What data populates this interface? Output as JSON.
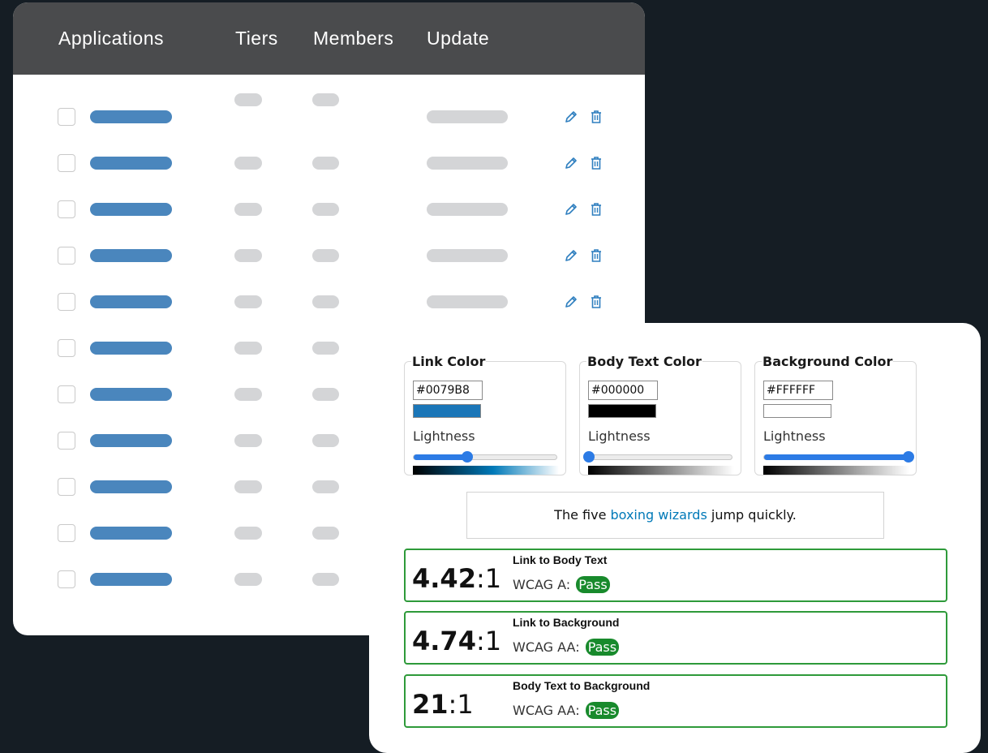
{
  "table": {
    "columns": {
      "applications": "Applications",
      "tiers": "Tiers",
      "members": "Members",
      "update": "Update"
    },
    "row_count": 11,
    "colors": {
      "header_bg": "#4a4b4d",
      "app_bar": "#4a86bd",
      "placeholder_bar": "#d4d5d7",
      "icon": "#2f7fbf"
    },
    "row_icons": [
      "pencil-icon",
      "trash-icon"
    ]
  },
  "contrast_checker": {
    "pickers": [
      {
        "legend": "Link Color",
        "hex": "#0079B8",
        "lightness_label": "Lightness",
        "lightness": 0.37,
        "swatch": "#1a76b8"
      },
      {
        "legend": "Body Text Color",
        "hex": "#000000",
        "lightness_label": "Lightness",
        "lightness": 0.0,
        "swatch": "#000000"
      },
      {
        "legend": "Background Color",
        "hex": "#FFFFFF",
        "lightness_label": "Lightness",
        "lightness": 1.0,
        "swatch": "#ffffff"
      }
    ],
    "sample": {
      "before": "The five ",
      "link": "boxing wizards",
      "after": " jump quickly."
    },
    "results": [
      {
        "ratio": "4.42",
        "suffix": ":1",
        "title": "Link to Body Text",
        "level": "WCAG A:",
        "status": "Pass"
      },
      {
        "ratio": "4.74",
        "suffix": ":1",
        "title": "Link to Background",
        "level": "WCAG AA:",
        "status": "Pass"
      },
      {
        "ratio": "21",
        "suffix": ":1",
        "title": "Body Text to Background",
        "level": "WCAG AA:",
        "status": "Pass"
      }
    ],
    "colors": {
      "pass_border": "#2e9a3a",
      "pass_badge": "#188a2c",
      "slider": "#2c7be5",
      "link": "#0079b8"
    }
  }
}
